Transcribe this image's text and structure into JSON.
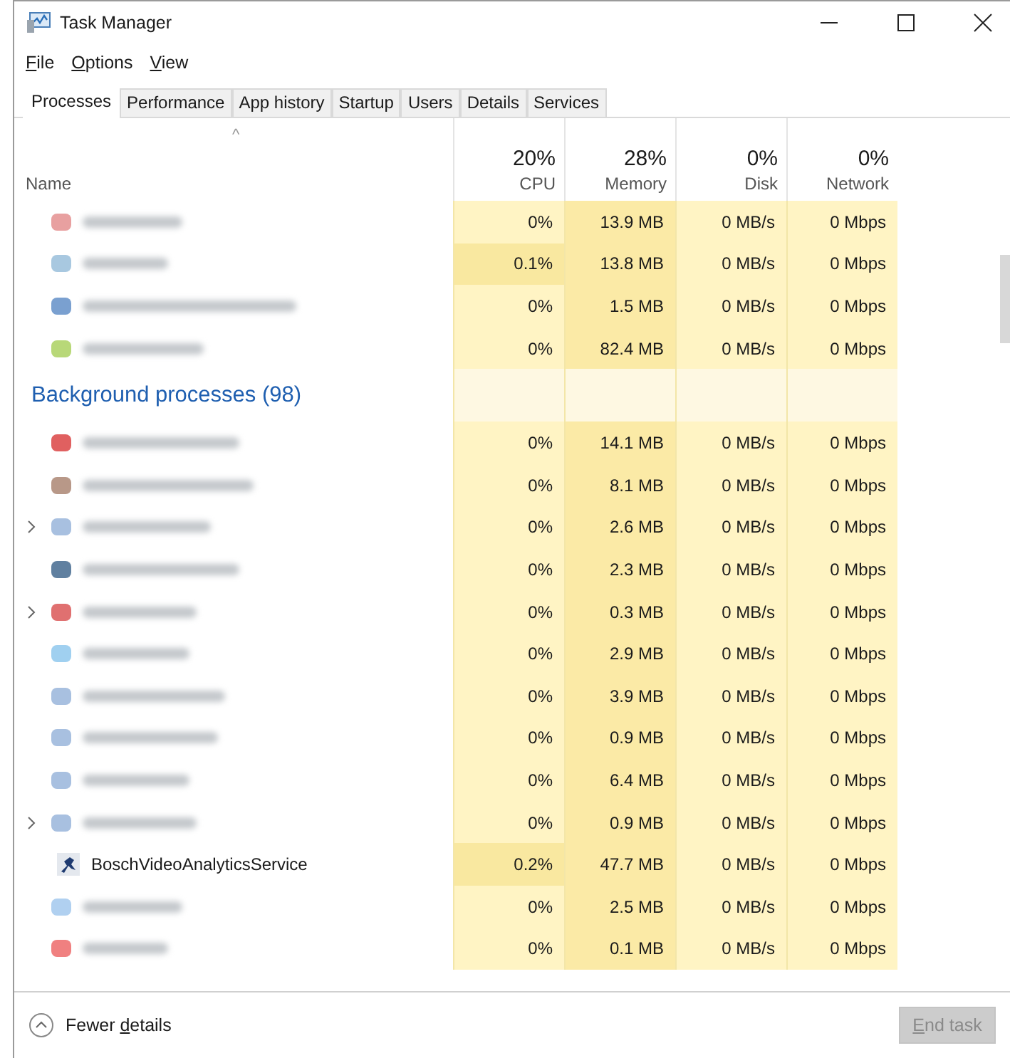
{
  "window": {
    "title": "Task Manager"
  },
  "menu": [
    {
      "key": "F",
      "rest": "ile"
    },
    {
      "key": "O",
      "rest": "ptions"
    },
    {
      "key": "V",
      "rest": "iew"
    }
  ],
  "tabs": [
    {
      "label": "Processes",
      "selected": true
    },
    {
      "label": "Performance",
      "selected": false
    },
    {
      "label": "App history",
      "selected": false
    },
    {
      "label": "Startup",
      "selected": false
    },
    {
      "label": "Users",
      "selected": false
    },
    {
      "label": "Details",
      "selected": false
    },
    {
      "label": "Services",
      "selected": false
    }
  ],
  "columns": {
    "name": "Name",
    "sort_arrow": "^",
    "metrics": [
      {
        "total": "20%",
        "label": "CPU"
      },
      {
        "total": "28%",
        "label": "Memory"
      },
      {
        "total": "0%",
        "label": "Disk"
      },
      {
        "total": "0%",
        "label": "Network"
      }
    ]
  },
  "rows": [
    {
      "kind": "blurred",
      "color": "#e8a0a0",
      "expandable": false,
      "cpu_active": false,
      "values": [
        "0%",
        "13.9 MB",
        "0 MB/s",
        "0 Mbps"
      ]
    },
    {
      "kind": "blurred",
      "color": "#a8c8e0",
      "expandable": false,
      "cpu_active": true,
      "values": [
        "0.1%",
        "13.8 MB",
        "0 MB/s",
        "0 Mbps"
      ]
    },
    {
      "kind": "blurred",
      "color": "#7aa0d0",
      "expandable": false,
      "cpu_active": false,
      "values": [
        "0%",
        "1.5 MB",
        "0 MB/s",
        "0 Mbps"
      ]
    },
    {
      "kind": "blurred",
      "color": "#b8d878",
      "expandable": false,
      "cpu_active": false,
      "values": [
        "0%",
        "82.4 MB",
        "0 MB/s",
        "0 Mbps"
      ]
    },
    {
      "kind": "group",
      "title": "Background processes (98)"
    },
    {
      "kind": "blurred",
      "color": "#e06060",
      "expandable": false,
      "cpu_active": false,
      "values": [
        "0%",
        "14.1 MB",
        "0 MB/s",
        "0 Mbps"
      ]
    },
    {
      "kind": "blurred",
      "color": "#b89888",
      "expandable": false,
      "cpu_active": false,
      "values": [
        "0%",
        "8.1 MB",
        "0 MB/s",
        "0 Mbps"
      ]
    },
    {
      "kind": "blurred",
      "color": "#a8c0e0",
      "expandable": true,
      "cpu_active": false,
      "values": [
        "0%",
        "2.6 MB",
        "0 MB/s",
        "0 Mbps"
      ]
    },
    {
      "kind": "blurred",
      "color": "#6080a0",
      "expandable": false,
      "cpu_active": false,
      "values": [
        "0%",
        "2.3 MB",
        "0 MB/s",
        "0 Mbps"
      ]
    },
    {
      "kind": "blurred",
      "color": "#e07070",
      "expandable": true,
      "cpu_active": false,
      "values": [
        "0%",
        "0.3 MB",
        "0 MB/s",
        "0 Mbps"
      ]
    },
    {
      "kind": "blurred",
      "color": "#a0d0f0",
      "expandable": false,
      "cpu_active": false,
      "values": [
        "0%",
        "2.9 MB",
        "0 MB/s",
        "0 Mbps"
      ]
    },
    {
      "kind": "blurred",
      "color": "#a8c0e0",
      "expandable": false,
      "cpu_active": false,
      "values": [
        "0%",
        "3.9 MB",
        "0 MB/s",
        "0 Mbps"
      ]
    },
    {
      "kind": "blurred",
      "color": "#a8c0e0",
      "expandable": false,
      "cpu_active": false,
      "values": [
        "0%",
        "0.9 MB",
        "0 MB/s",
        "0 Mbps"
      ]
    },
    {
      "kind": "blurred",
      "color": "#a8c0e0",
      "expandable": false,
      "cpu_active": false,
      "values": [
        "0%",
        "6.4 MB",
        "0 MB/s",
        "0 Mbps"
      ]
    },
    {
      "kind": "blurred",
      "color": "#a8c0e0",
      "expandable": true,
      "cpu_active": false,
      "values": [
        "0%",
        "0.9 MB",
        "0 MB/s",
        "0 Mbps"
      ]
    },
    {
      "kind": "named",
      "name": "BoschVideoAnalyticsService",
      "expandable": false,
      "cpu_active": true,
      "values": [
        "0.2%",
        "47.7 MB",
        "0 MB/s",
        "0 Mbps"
      ]
    },
    {
      "kind": "blurred",
      "color": "#b0d0f0",
      "expandable": false,
      "cpu_active": false,
      "values": [
        "0%",
        "2.5 MB",
        "0 MB/s",
        "0 Mbps"
      ]
    },
    {
      "kind": "blurred",
      "color": "#f08080",
      "expandable": false,
      "cpu_active": false,
      "values": [
        "0%",
        "0.1 MB",
        "0 MB/s",
        "0 Mbps"
      ]
    }
  ],
  "footer": {
    "fewer": {
      "pre": "Fewer ",
      "key": "d",
      "rest": "etails"
    },
    "end_task": {
      "key": "E",
      "rest": "nd task",
      "disabled": true
    }
  }
}
